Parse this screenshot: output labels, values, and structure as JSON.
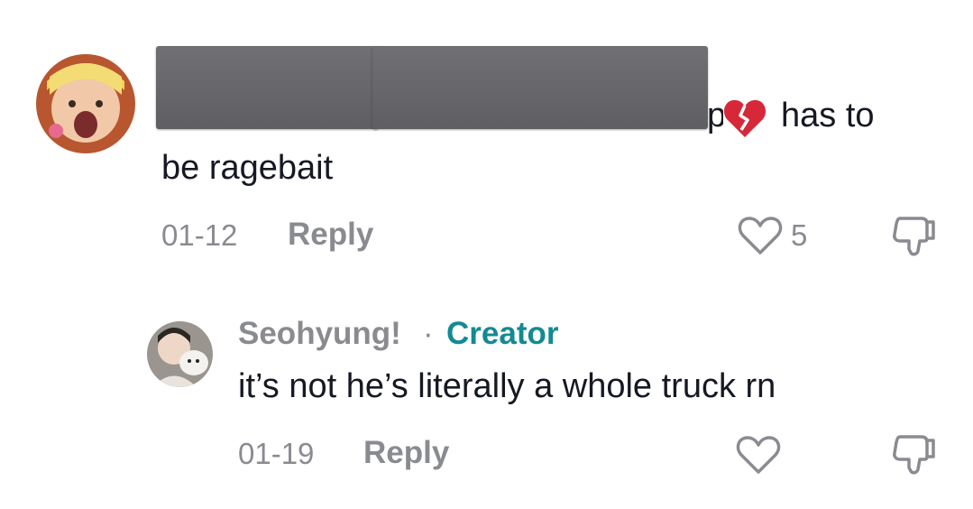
{
  "comments": [
    {
      "text_line1_visible": "has to",
      "text_line2": "be ragebait",
      "date": "01-12",
      "reply_label": "Reply",
      "like_count": "5",
      "emoji": "💔"
    },
    {
      "username": "Seohyung!",
      "separator": "·",
      "badge": "Creator",
      "text": "it’s not he’s literally a whole truck rn",
      "date": "01-19",
      "reply_label": "Reply"
    }
  ],
  "colors": {
    "creator": "#138a93",
    "muted": "#8a8b91",
    "text": "#161823",
    "broken_heart": "#d62839"
  }
}
